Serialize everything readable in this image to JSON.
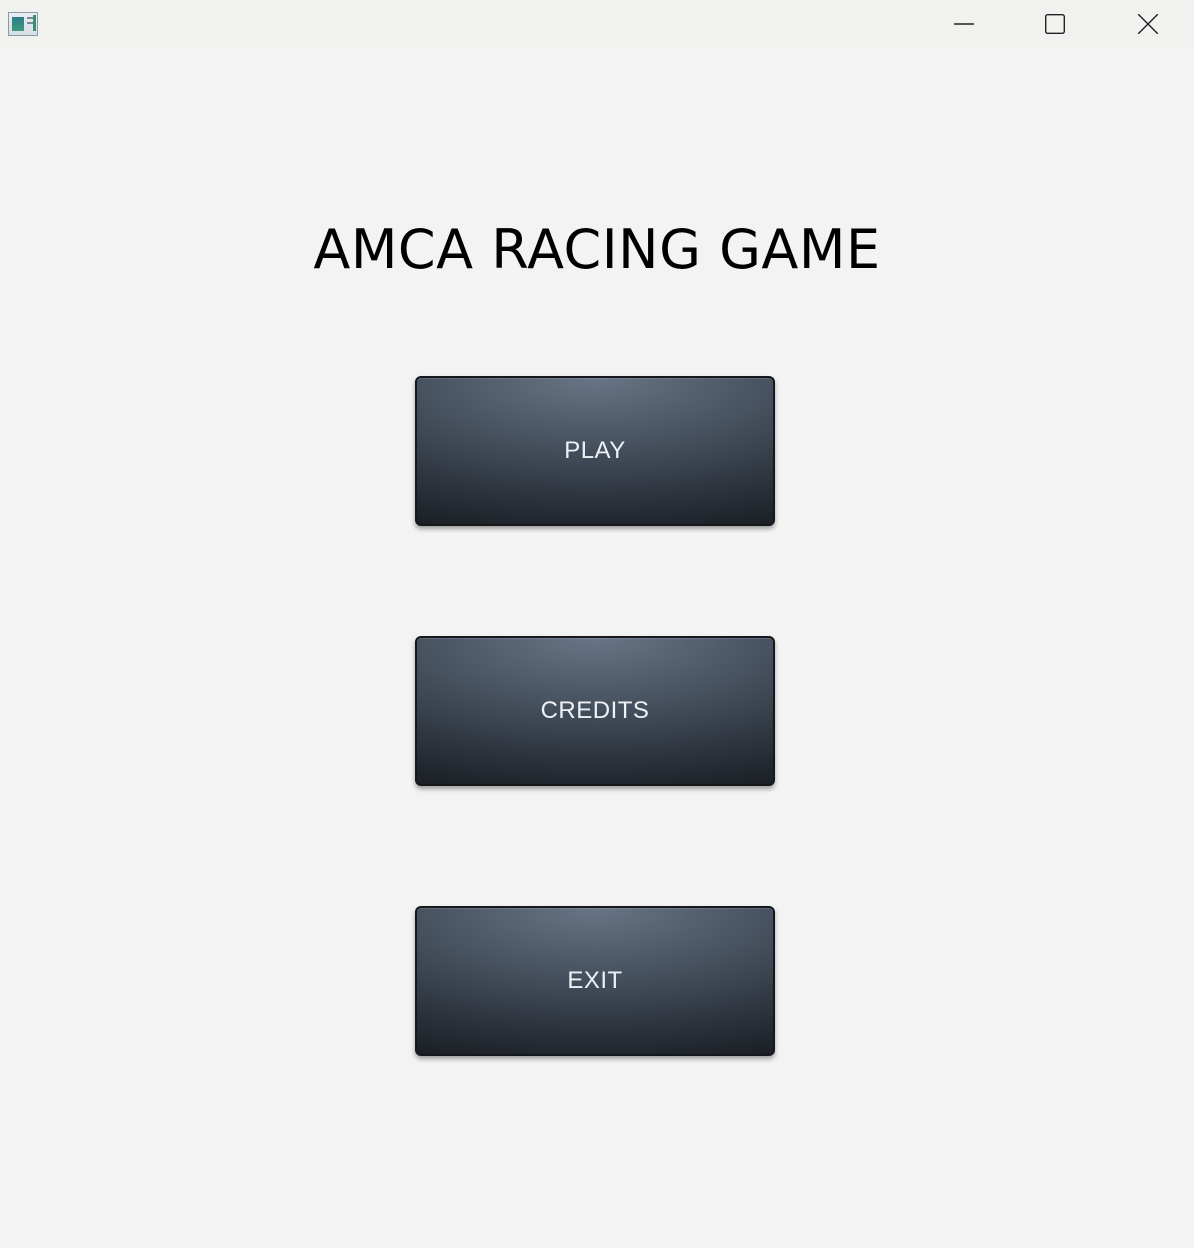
{
  "window": {
    "controls": {
      "minimize_icon": "minimize-icon",
      "maximize_icon": "maximize-icon",
      "close_icon": "close-icon"
    }
  },
  "game": {
    "title": "AMCA RACING GAME"
  },
  "menu": {
    "play_label": "PLAY",
    "credits_label": "CREDITS",
    "exit_label": "EXIT"
  },
  "colors": {
    "background": "#f3f3f3",
    "button_top": "#677586",
    "button_bottom": "#1b1f25",
    "button_text": "#eef1f4"
  }
}
